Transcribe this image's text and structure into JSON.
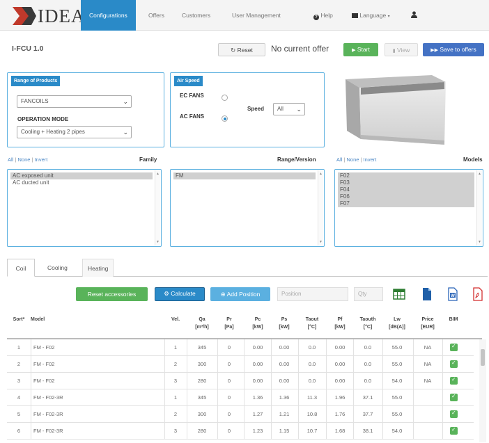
{
  "nav": {
    "logo": "IDEA",
    "items": [
      {
        "label": "Configurations",
        "active": true
      },
      {
        "label": "Offers"
      },
      {
        "label": "Customers"
      },
      {
        "label": "User Management"
      },
      {
        "label": "Help",
        "icon": "help-icon"
      },
      {
        "label": "Language",
        "icon": "flag-icon"
      }
    ],
    "user_icon": "user-icon"
  },
  "toolbar": {
    "title": "I-FCU 1.0",
    "reset_label": "Reset",
    "offer_status": "No current offer",
    "start_label": "Start",
    "view_label": "View",
    "save_label": "Save to offers"
  },
  "range_panel": {
    "title": "Range of Products",
    "product": "FANCOILS",
    "mode_label": "OPERATION MODE",
    "mode": "Cooling + Heating 2 pipes"
  },
  "air_panel": {
    "title": "Air Speed",
    "ec_label": "EC FANS",
    "ac_label": "AC FANS",
    "selected": "ac",
    "speed_label": "Speed",
    "speed_value": "All"
  },
  "filter_links": {
    "all": "All",
    "none": "None",
    "invert": "Invert",
    "sep": "|"
  },
  "family": {
    "header": "Family",
    "items": [
      {
        "label": "AC exposed unit",
        "selected": true
      },
      {
        "label": "AC ducted unit",
        "selected": false
      }
    ]
  },
  "range_version": {
    "header": "Range/Version",
    "items": [
      {
        "label": "FM",
        "selected": true
      }
    ]
  },
  "models": {
    "header": "Models",
    "items": [
      {
        "label": "F02",
        "selected": true
      },
      {
        "label": "F03",
        "selected": true
      },
      {
        "label": "F04",
        "selected": true
      },
      {
        "label": "F06",
        "selected": true
      },
      {
        "label": "F07",
        "selected": true
      }
    ]
  },
  "tabs": [
    {
      "label": "Coil",
      "active": true
    },
    {
      "label": "Cooling"
    },
    {
      "label": "Heating"
    }
  ],
  "actions": {
    "reset_acc": "Reset accessories",
    "calculate": "Calculate",
    "add_position": "Add Position",
    "position_placeholder": "Position",
    "qty_placeholder": "Qty"
  },
  "table": {
    "headers": [
      {
        "l1": "Sort*",
        "l2": ""
      },
      {
        "l1": "Model",
        "l2": ""
      },
      {
        "l1": "Vel.",
        "l2": ""
      },
      {
        "l1": "Qa",
        "l2": "[m³/h]"
      },
      {
        "l1": "Pr",
        "l2": "[Pa]"
      },
      {
        "l1": "Pc",
        "l2": "[kW]"
      },
      {
        "l1": "Ps",
        "l2": "[kW]"
      },
      {
        "l1": "Taout",
        "l2": "[°C]"
      },
      {
        "l1": "Pf",
        "l2": "[kW]"
      },
      {
        "l1": "Taouth",
        "l2": "[°C]"
      },
      {
        "l1": "Lw",
        "l2": "[dB(A)]"
      },
      {
        "l1": "Price",
        "l2": "[EUR]"
      },
      {
        "l1": "BIM",
        "l2": ""
      }
    ],
    "rows": [
      {
        "sort": "1",
        "model": "FM - F02",
        "vel": "1",
        "qa": "345",
        "pr": "0",
        "pc": "0.00",
        "ps": "0.00",
        "taout": "0.0",
        "pf": "0.00",
        "taouth": "0.0",
        "lw": "55.0",
        "price": "NA"
      },
      {
        "sort": "2",
        "model": "FM - F02",
        "vel": "2",
        "qa": "300",
        "pr": "0",
        "pc": "0.00",
        "ps": "0.00",
        "taout": "0.0",
        "pf": "0.00",
        "taouth": "0.0",
        "lw": "55.0",
        "price": "NA"
      },
      {
        "sort": "3",
        "model": "FM - F02",
        "vel": "3",
        "qa": "280",
        "pr": "0",
        "pc": "0.00",
        "ps": "0.00",
        "taout": "0.0",
        "pf": "0.00",
        "taouth": "0.0",
        "lw": "54.0",
        "price": "NA"
      },
      {
        "sort": "4",
        "model": "FM - F02-3R",
        "vel": "1",
        "qa": "345",
        "pr": "0",
        "pc": "1.36",
        "ps": "1.36",
        "taout": "11.3",
        "pf": "1.96",
        "taouth": "37.1",
        "lw": "55.0",
        "price": ""
      },
      {
        "sort": "5",
        "model": "FM - F02-3R",
        "vel": "2",
        "qa": "300",
        "pr": "0",
        "pc": "1.27",
        "ps": "1.21",
        "taout": "10.8",
        "pf": "1.76",
        "taouth": "37.7",
        "lw": "55.0",
        "price": ""
      },
      {
        "sort": "6",
        "model": "FM - F02-3R",
        "vel": "3",
        "qa": "280",
        "pr": "0",
        "pc": "1.23",
        "ps": "1.15",
        "taout": "10.7",
        "pf": "1.68",
        "taouth": "38.1",
        "lw": "54.0",
        "price": ""
      }
    ]
  },
  "colors": {
    "primary": "#2a8ac8",
    "success": "#59b35a",
    "save": "#4472c4",
    "panel_border": "#5bb0e0"
  }
}
